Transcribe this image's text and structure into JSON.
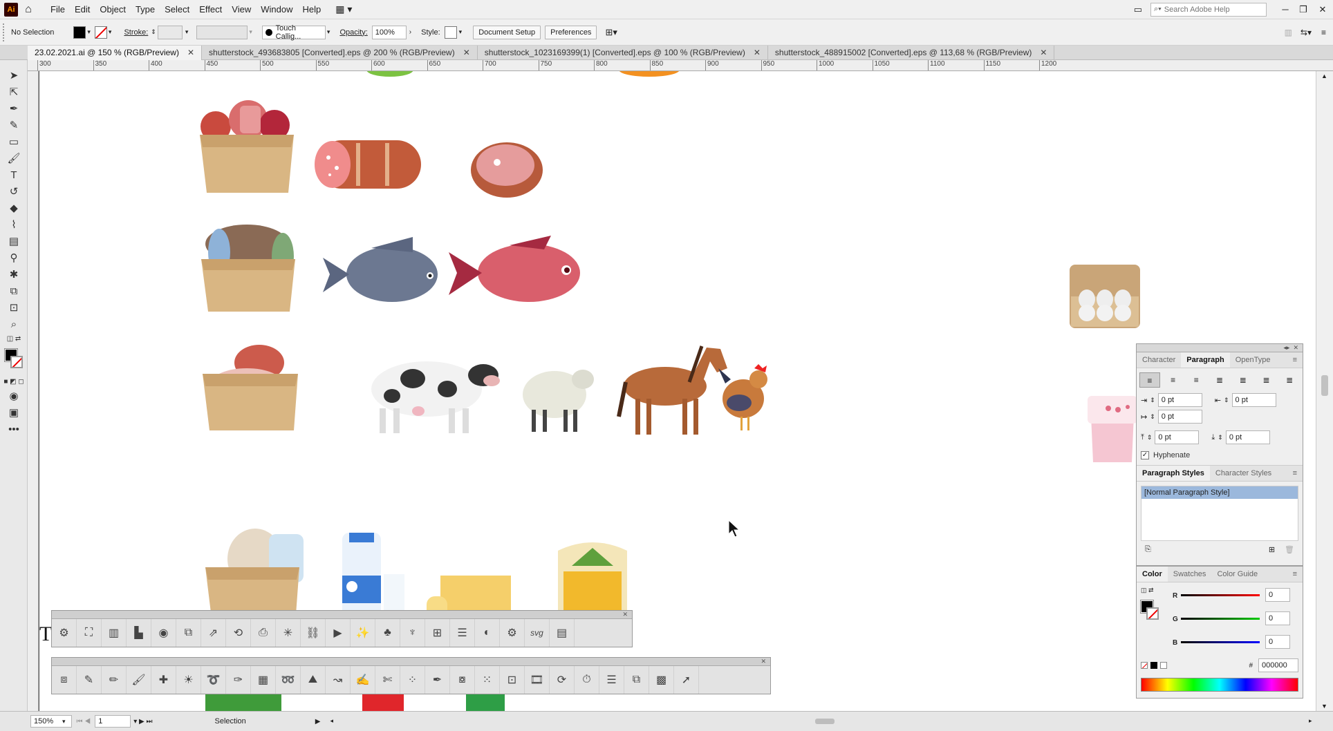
{
  "app": {
    "logo": "Ai",
    "home_icon": "home-icon"
  },
  "menu": [
    "File",
    "Edit",
    "Object",
    "Type",
    "Select",
    "Effect",
    "View",
    "Window",
    "Help"
  ],
  "search": {
    "placeholder": "Search Adobe Help"
  },
  "control": {
    "selection_label": "No Selection",
    "stroke_label": "Stroke:",
    "brush_name": "Touch Callig...",
    "opacity_label": "Opacity:",
    "opacity_value": "100%",
    "style_label": "Style:",
    "document_setup": "Document Setup",
    "preferences": "Preferences"
  },
  "tabs": [
    {
      "label": "23.02.2021.ai @ 150 % (RGB/Preview)",
      "active": true
    },
    {
      "label": "shutterstock_493683805 [Converted].eps @ 200 % (RGB/Preview)"
    },
    {
      "label": "shutterstock_1023169399(1) [Converted].eps @ 100 % (RGB/Preview)"
    },
    {
      "label": "shutterstock_488915002 [Converted].eps @ 113,68 % (RGB/Preview)"
    }
  ],
  "ruler_ticks": [
    "300",
    "350",
    "400",
    "450",
    "500",
    "550",
    "600",
    "650",
    "700",
    "750",
    "800",
    "850",
    "900",
    "950",
    "1000",
    "1050",
    "1100",
    "1150",
    "1200"
  ],
  "paragraph_panel": {
    "tabs": [
      "Character",
      "Paragraph",
      "OpenType"
    ],
    "left_indent": "0 pt",
    "right_indent": "0 pt",
    "first_line_indent": "0 pt",
    "space_before": "0 pt",
    "space_after": "0 pt",
    "hyphenate_label": "Hyphenate",
    "style_tabs": [
      "Paragraph Styles",
      "Character Styles"
    ],
    "selected_style": "[Normal Paragraph Style]"
  },
  "color_panel": {
    "tabs": [
      "Color",
      "Swatches",
      "Color Guide"
    ],
    "r_label": "R",
    "g_label": "G",
    "b_label": "B",
    "r": "0",
    "g": "0",
    "b": "0",
    "hex_label": "#",
    "hex": "000000"
  },
  "status": {
    "zoom": "150%",
    "page": "1",
    "tool": "Selection"
  },
  "canvas_fragment_text": "T"
}
